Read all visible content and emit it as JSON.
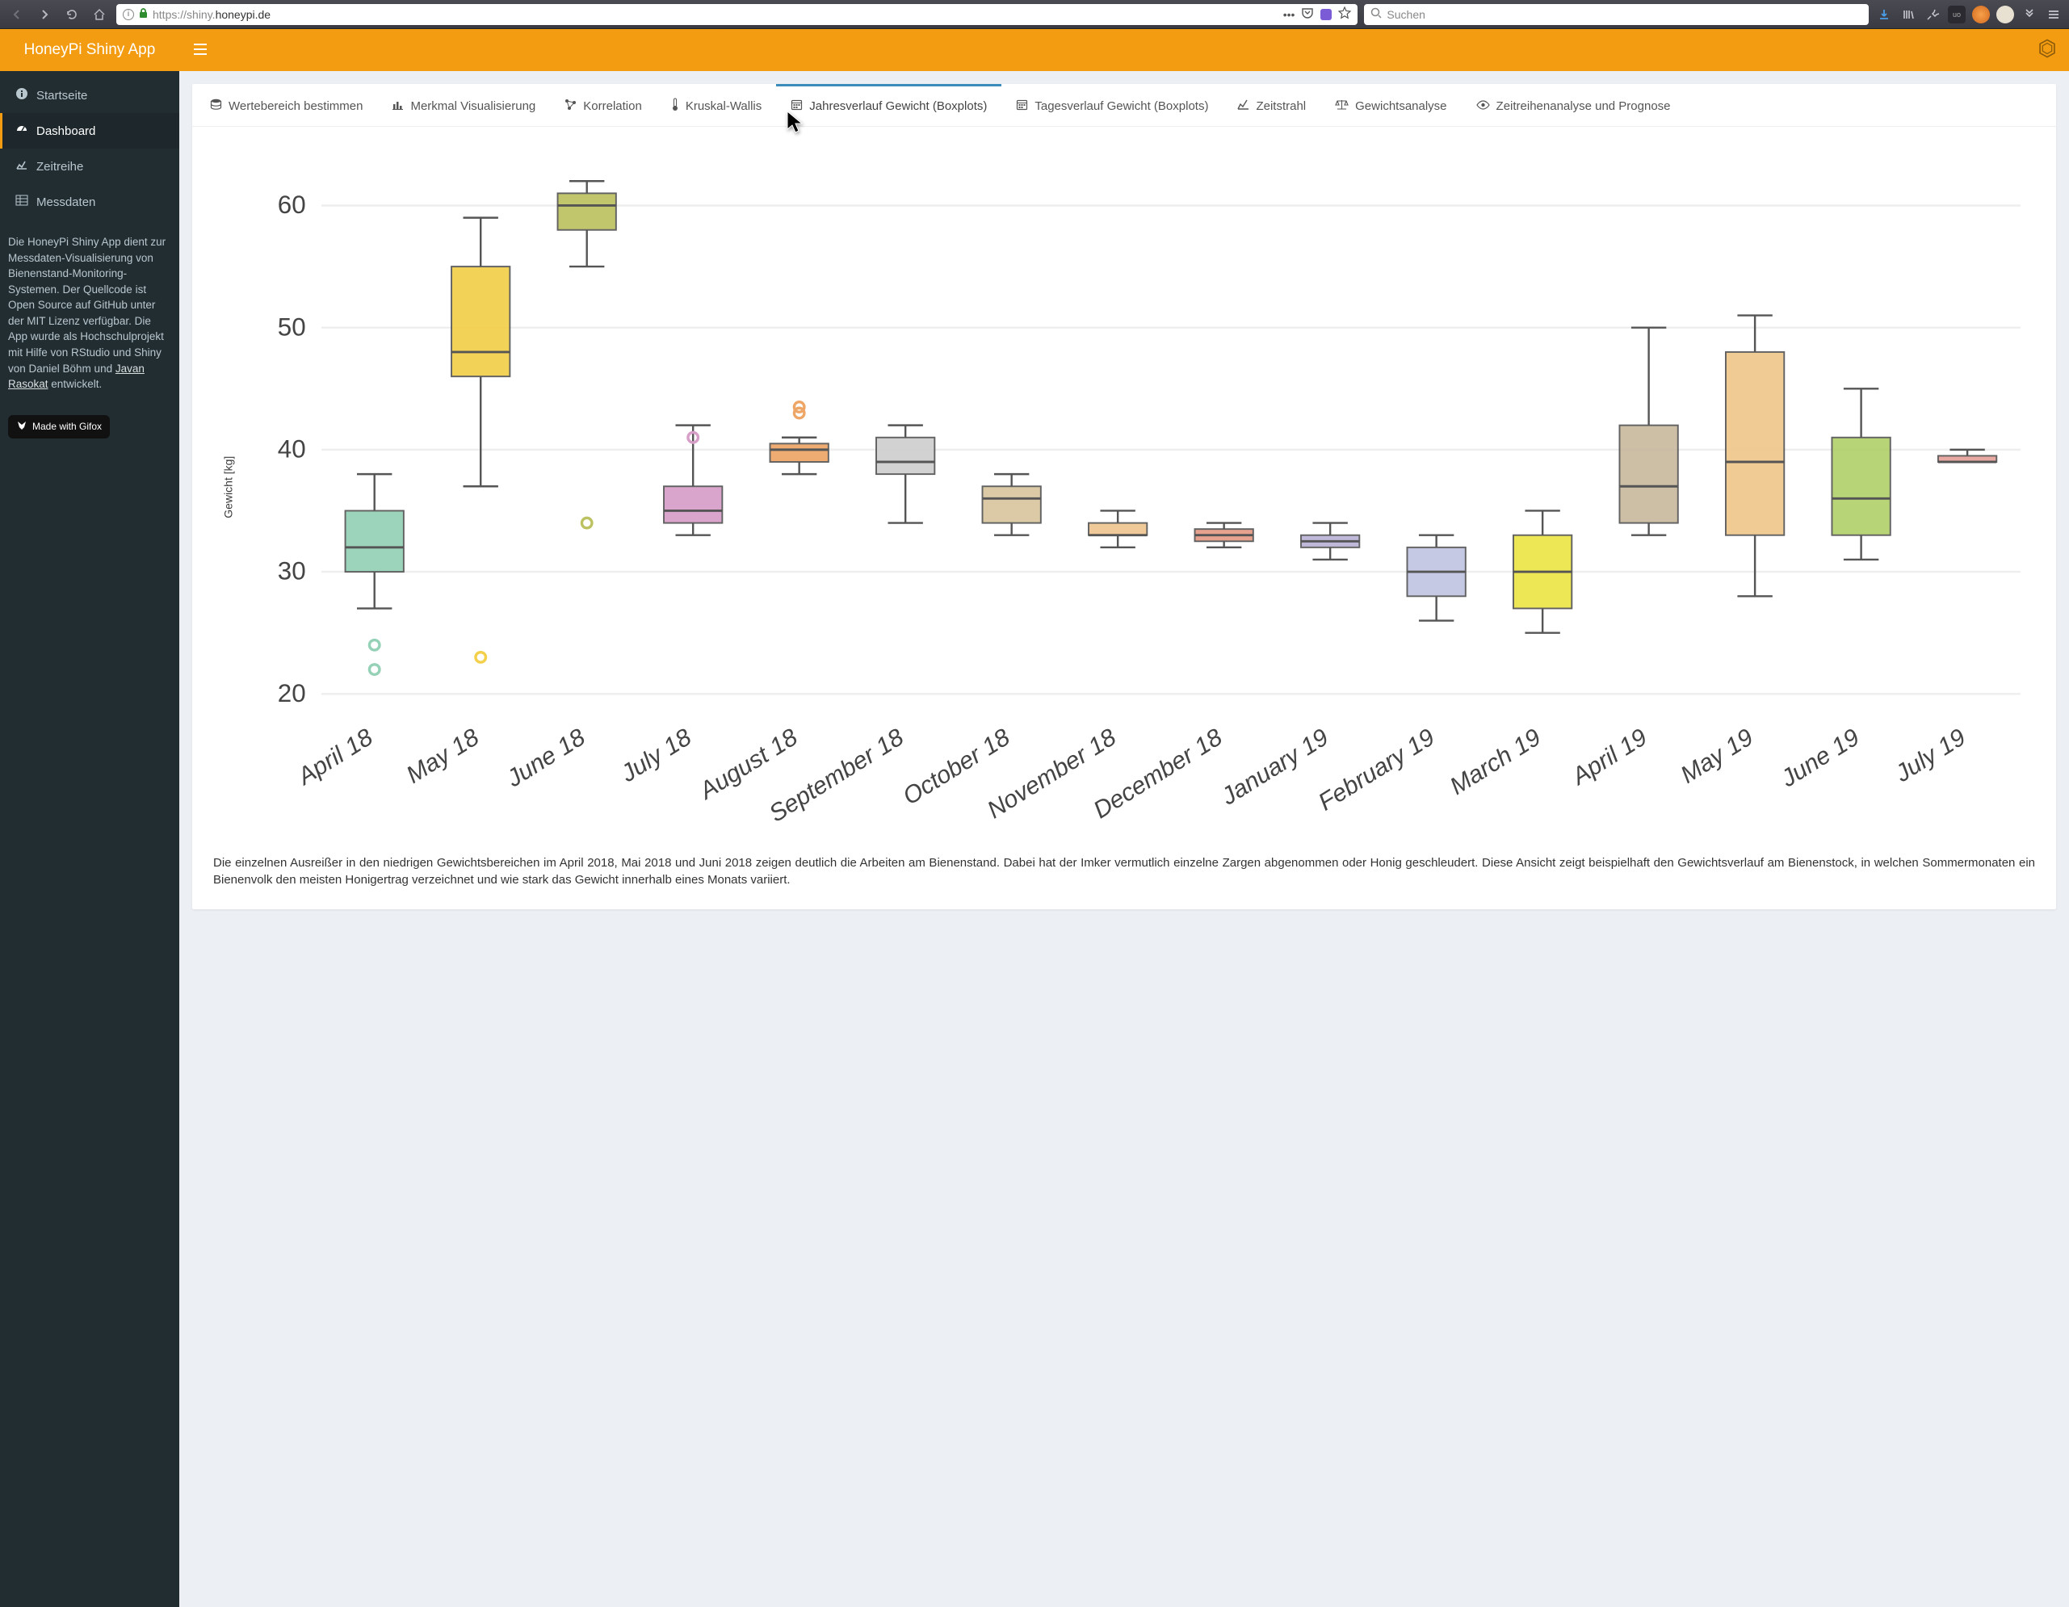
{
  "browser": {
    "url_proto": "https://",
    "url_host": "shiny.",
    "url_domain": "honeypi.de",
    "search_placeholder": "Suchen"
  },
  "header": {
    "title": "HoneyPi Shiny App"
  },
  "sidebar": {
    "items": [
      {
        "icon": "info",
        "label": "Startseite"
      },
      {
        "icon": "dash",
        "label": "Dashboard"
      },
      {
        "icon": "line",
        "label": "Zeitreihe"
      },
      {
        "icon": "table",
        "label": "Messdaten"
      }
    ],
    "desc_part1": "Die HoneyPi Shiny App dient zur Messdaten-Visualisierung von Bienenstand-Monitoring-Systemen. Der Quellcode ist Open Source auf GitHub unter der MIT Lizenz verfügbar. Die App wurde als Hochschulprojekt mit Hilfe von RStudio und Shiny von Daniel Böhm und ",
    "desc_link": "Javan Rasokat",
    "desc_part2": " entwickelt.",
    "made_with": "Made with Gifox"
  },
  "tabs": [
    {
      "icon": "db",
      "label": "Wertebereich bestimmen"
    },
    {
      "icon": "bar",
      "label": "Merkmal Visualisierung"
    },
    {
      "icon": "net",
      "label": "Korrelation"
    },
    {
      "icon": "therm",
      "label": "Kruskal-Wallis"
    },
    {
      "icon": "cal",
      "label": "Jahresverlauf Gewicht (Boxplots)"
    },
    {
      "icon": "cal",
      "label": "Tagesverlauf Gewicht (Boxplots)"
    },
    {
      "icon": "line",
      "label": "Zeitstrahl"
    },
    {
      "icon": "scale",
      "label": "Gewichtsanalyse"
    },
    {
      "icon": "eye",
      "label": "Zeitreihenanalyse und Prognose"
    }
  ],
  "active_tab_index": 4,
  "chart_desc": "Die einzelnen Ausreißer in den niedrigen Gewichtsbereichen im April 2018, Mai 2018 und Juni 2018 zeigen deutlich die Arbeiten am Bienenstand. Dabei hat der Imker vermutlich einzelne Zargen abgenommen oder Honig geschleudert. Diese Ansicht zeigt beispielhaft den Gewichtsverlauf am Bienenstock, in welchen Sommermonaten ein Bienenvolk den meisten Honigertrag verzeichnet und wie stark das Gewicht innerhalb eines Monats variiert.",
  "chart_data": {
    "type": "boxplot",
    "ylabel": "Gewicht [kg]",
    "ylim": [
      18,
      63
    ],
    "yticks": [
      20,
      30,
      40,
      50,
      60
    ],
    "categories": [
      "April 18",
      "May 18",
      "June 18",
      "July 18",
      "August 18",
      "September 18",
      "October 18",
      "November 18",
      "December 18",
      "January 19",
      "February 19",
      "March 19",
      "April 19",
      "May 19",
      "June 19",
      "July 19"
    ],
    "series": [
      {
        "min": 27,
        "q1": 30,
        "median": 32,
        "q3": 35,
        "max": 38,
        "outliers": [
          22,
          24
        ],
        "color": "#94d1b6"
      },
      {
        "min": 37,
        "q1": 46,
        "median": 48,
        "q3": 55,
        "max": 59,
        "outliers": [
          23
        ],
        "color": "#f3cf4a"
      },
      {
        "min": 55,
        "q1": 58,
        "median": 60,
        "q3": 61,
        "max": 62,
        "outliers": [
          34
        ],
        "color": "#bcc261"
      },
      {
        "min": 33,
        "q1": 34,
        "median": 35,
        "q3": 37,
        "max": 42,
        "outliers": [
          41
        ],
        "color": "#d79ec8"
      },
      {
        "min": 38,
        "q1": 39,
        "median": 40,
        "q3": 40.5,
        "max": 41,
        "outliers": [
          43,
          43.5
        ],
        "color": "#eea667"
      },
      {
        "min": 34,
        "q1": 38,
        "median": 39,
        "q3": 41,
        "max": 42,
        "outliers": [],
        "color": "#cfcfcf"
      },
      {
        "min": 33,
        "q1": 34,
        "median": 36,
        "q3": 37,
        "max": 38,
        "outliers": [],
        "color": "#d9c69e"
      },
      {
        "min": 32,
        "q1": 33,
        "median": 33,
        "q3": 34,
        "max": 35,
        "outliers": [],
        "color": "#eec590"
      },
      {
        "min": 32,
        "q1": 32.5,
        "median": 33,
        "q3": 33.5,
        "max": 34,
        "outliers": [],
        "color": "#e59a86"
      },
      {
        "min": 31,
        "q1": 32,
        "median": 32.5,
        "q3": 33,
        "max": 34,
        "outliers": [],
        "color": "#bcb4d6"
      },
      {
        "min": 26,
        "q1": 28,
        "median": 30,
        "q3": 32,
        "max": 33,
        "outliers": [],
        "color": "#c1c5e2"
      },
      {
        "min": 25,
        "q1": 27,
        "median": 30,
        "q3": 33,
        "max": 35,
        "outliers": [],
        "color": "#ece447"
      },
      {
        "min": 33,
        "q1": 34,
        "median": 37,
        "q3": 42,
        "max": 50,
        "outliers": [],
        "color": "#c9b99f"
      },
      {
        "min": 28,
        "q1": 33,
        "median": 39,
        "q3": 48,
        "max": 51,
        "outliers": [],
        "color": "#f0c78c"
      },
      {
        "min": 31,
        "q1": 33,
        "median": 36,
        "q3": 41,
        "max": 45,
        "outliers": [],
        "color": "#b1d16b"
      },
      {
        "min": 39,
        "q1": 39,
        "median": 39,
        "q3": 39.5,
        "max": 40,
        "outliers": [],
        "color": "#e5a29a"
      }
    ]
  }
}
